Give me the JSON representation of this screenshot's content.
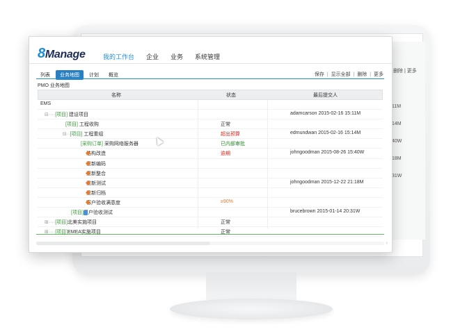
{
  "app": {
    "logo_num": "8",
    "logo_text": "Manage",
    "nav": [
      "我的工作台",
      "企业",
      "业务",
      "系统管理"
    ],
    "tabs": [
      "列表",
      "业务地图",
      "计划",
      "概览"
    ],
    "active_tab": "业务地图",
    "toolbar": [
      "保存",
      "显示全部",
      "删除",
      "更多"
    ],
    "breadcrumb": "PMO 业务地图",
    "columns": {
      "name": "名称",
      "status": "状态",
      "submitter": "最后提交人"
    },
    "rows": [
      {
        "prefix": "",
        "tag": "",
        "name": "EMS",
        "status": "",
        "submitter": ""
      },
      {
        "prefix": "⊟",
        "tag": "[项目]",
        "name": "建设项目",
        "status": "",
        "submitter": "adamcarson 2015-02-16 15:11M"
      },
      {
        "prefix": "",
        "tag": "[项目]",
        "name": "工程收购",
        "status": "正常",
        "submitter": ""
      },
      {
        "prefix": "⊟",
        "tag": "[项目]",
        "name": "工程重组",
        "status": "超出预算",
        "submitter": "edmundwan 2015-02-16 15:14M"
      },
      {
        "prefix": "",
        "tag": "[采购订单]",
        "name": "采购网络服务器",
        "status": "已内部审批",
        "submitter": ""
      },
      {
        "prefix": "",
        "tag": "",
        "name": "结构改造",
        "status": "逾期",
        "submitter": "johngoodman 2015-08-26 15:40W"
      },
      {
        "prefix": "",
        "tag": "",
        "name": "重新编码",
        "status": "",
        "submitter": ""
      },
      {
        "prefix": "",
        "tag": "",
        "name": "重新整合",
        "status": "",
        "submitter": ""
      },
      {
        "prefix": "",
        "tag": "",
        "name": "重新测试",
        "status": "",
        "submitter": "johngoodman 2015-12-22 21:18M"
      },
      {
        "prefix": "",
        "tag": "",
        "name": "重新归档",
        "status": "",
        "submitter": ""
      },
      {
        "prefix": "",
        "tag": "",
        "name": "客户验收满意度",
        "status": "≥90%",
        "submitter": ""
      },
      {
        "prefix": "",
        "tag": "[项目]",
        "name": "用户验收测试",
        "status": "",
        "submitter": "brucebrown 2015-01-14 20:31W"
      },
      {
        "prefix": "⊞",
        "tag": "[项目]",
        "name": "北美实施项目",
        "status": "正常",
        "submitter": ""
      },
      {
        "prefix": "⊞",
        "tag": "[项目]",
        "name": "EMEA实施项目",
        "status": "正常",
        "submitter": ""
      }
    ]
  },
  "background": {
    "actions": "删除 | 更多",
    "times": [
      "11M",
      "14M",
      "40W",
      "18M",
      "31W"
    ]
  },
  "colors": {
    "accent": "#1e8fd6",
    "tag": "#3a9b3a",
    "alert": "#d42a1f",
    "ok": "#2a8a2a",
    "metric": "#e8792b"
  }
}
